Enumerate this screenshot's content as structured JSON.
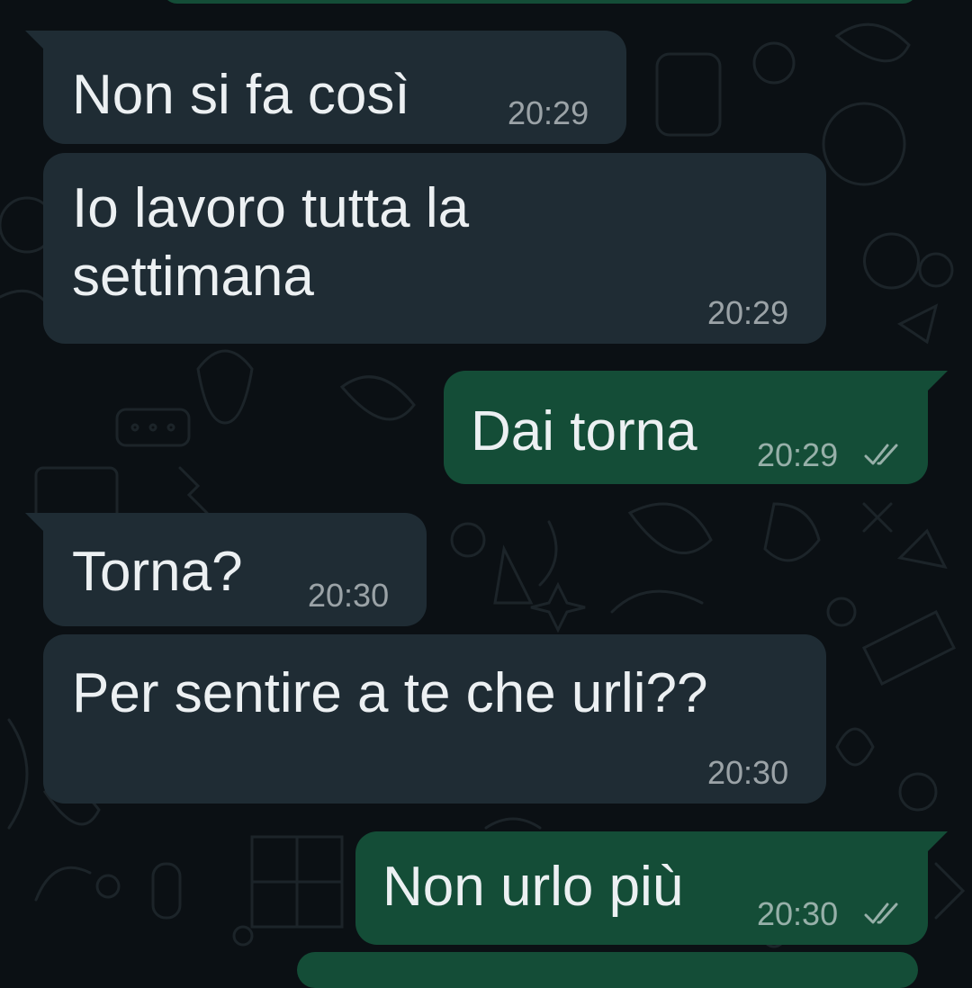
{
  "colors": {
    "background": "#0b1014",
    "incoming_bubble": "#1f2c34",
    "outgoing_bubble": "#144d37",
    "text": "#ecf0f2",
    "timestamp": "#9aa3a8"
  },
  "messages": [
    {
      "direction": "incoming",
      "text": "Non si fa così",
      "time": "20:29"
    },
    {
      "direction": "incoming",
      "text": "Io lavoro tutta la\nsettimana",
      "time": "20:29"
    },
    {
      "direction": "outgoing",
      "text": "Dai torna",
      "time": "20:29",
      "status_icon": "double-check-icon"
    },
    {
      "direction": "incoming",
      "text": "Torna?",
      "time": "20:30"
    },
    {
      "direction": "incoming",
      "text": "Per sentire a te che urli??",
      "time": "20:30"
    },
    {
      "direction": "outgoing",
      "text": "Non urlo più",
      "time": "20:30",
      "status_icon": "double-check-icon"
    }
  ]
}
